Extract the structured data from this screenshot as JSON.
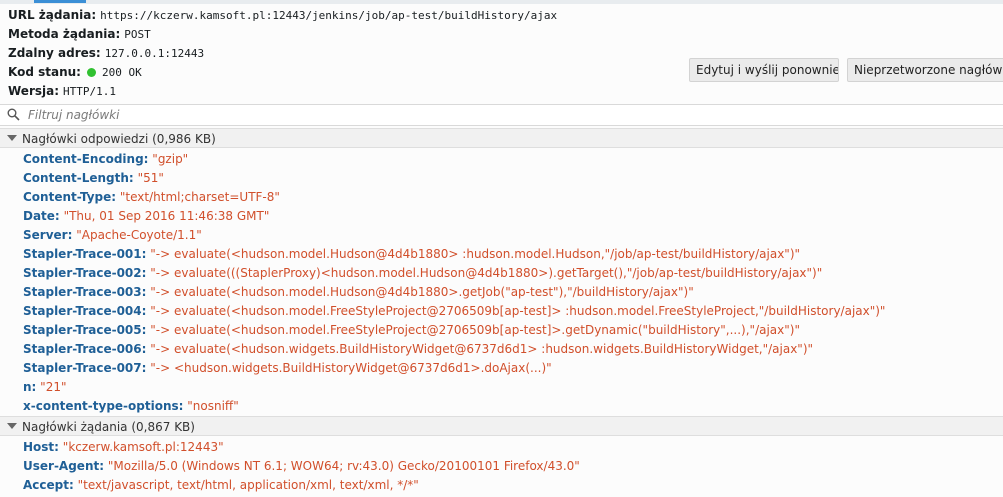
{
  "summary": {
    "url_label": "URL żądania:",
    "url_value": "https://kczerw.kamsoft.pl:12443/jenkins/job/ap-test/buildHistory/ajax",
    "method_label": "Metoda żądania:",
    "method_value": "POST",
    "remote_label": "Zdalny adres:",
    "remote_value": "127.0.0.1:12443",
    "status_label": "Kod stanu:",
    "status_value": "200 OK",
    "status_color": "#31c131",
    "version_label": "Wersja:",
    "version_value": "HTTP/1.1"
  },
  "buttons": {
    "edit_resend": "Edytuj i wyślij ponownie",
    "raw_headers": "Nieprzetworzone nagłówki"
  },
  "filter": {
    "placeholder": "Filtruj nagłówki",
    "icon": "search-icon"
  },
  "response_section": {
    "title": "Nagłówki odpowiedzi (0,986 KB)",
    "headers": [
      {
        "name": "Content-Encoding:",
        "value": "\"gzip\""
      },
      {
        "name": "Content-Length:",
        "value": "\"51\""
      },
      {
        "name": "Content-Type:",
        "value": "\"text/html;charset=UTF-8\""
      },
      {
        "name": "Date:",
        "value": "\"Thu, 01 Sep 2016 11:46:38 GMT\""
      },
      {
        "name": "Server:",
        "value": "\"Apache-Coyote/1.1\""
      },
      {
        "name": "Stapler-Trace-001:",
        "value": "\"-> evaluate(<hudson.model.Hudson@4d4b1880> :hudson.model.Hudson,\"/job/ap-test/buildHistory/ajax\")\""
      },
      {
        "name": "Stapler-Trace-002:",
        "value": "\"-> evaluate(((StaplerProxy)<hudson.model.Hudson@4d4b1880>).getTarget(),\"/job/ap-test/buildHistory/ajax\")\""
      },
      {
        "name": "Stapler-Trace-003:",
        "value": "\"-> evaluate(<hudson.model.Hudson@4d4b1880>.getJob(\"ap-test\"),\"/buildHistory/ajax\")\""
      },
      {
        "name": "Stapler-Trace-004:",
        "value": "\"-> evaluate(<hudson.model.FreeStyleProject@2706509b[ap-test]> :hudson.model.FreeStyleProject,\"/buildHistory/ajax\")\""
      },
      {
        "name": "Stapler-Trace-005:",
        "value": "\"-> evaluate(<hudson.model.FreeStyleProject@2706509b[ap-test]>.getDynamic(\"buildHistory\",...),\"/ajax\")\""
      },
      {
        "name": "Stapler-Trace-006:",
        "value": "\"-> evaluate(<hudson.widgets.BuildHistoryWidget@6737d6d1> :hudson.widgets.BuildHistoryWidget,\"/ajax\")\""
      },
      {
        "name": "Stapler-Trace-007:",
        "value": "\"->  <hudson.widgets.BuildHistoryWidget@6737d6d1>.doAjax(...)\""
      },
      {
        "name": "n:",
        "value": "\"21\""
      },
      {
        "name": "x-content-type-options:",
        "value": "\"nosniff\""
      }
    ]
  },
  "request_section": {
    "title": "Nagłówki żądania (0,867 KB)",
    "headers": [
      {
        "name": "Host:",
        "value": "\"kczerw.kamsoft.pl:12443\""
      },
      {
        "name": "User-Agent:",
        "value": "\"Mozilla/5.0 (Windows NT 6.1; WOW64; rv:43.0) Gecko/20100101 Firefox/43.0\""
      },
      {
        "name": "Accept:",
        "value": "\"text/javascript, text/html, application/xml, text/xml, */*\""
      }
    ]
  },
  "colors": {
    "header_name": "#1f5f96",
    "header_value": "#d14f2b",
    "accent": "#3b8fd6"
  }
}
